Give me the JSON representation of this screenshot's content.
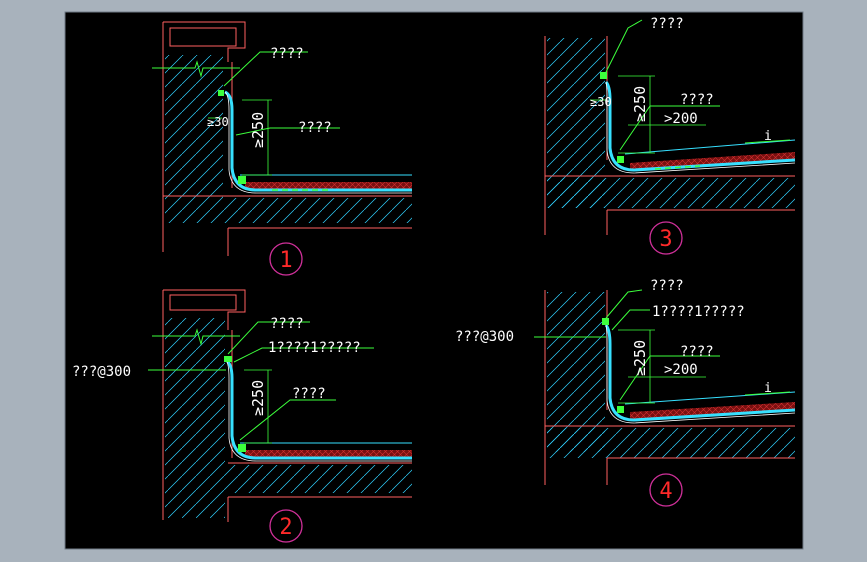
{
  "colors": {
    "frame": "#a8b2bc",
    "frame_edge": "#6f7a86",
    "background": "#000000",
    "concrete_outline": "#ff6060",
    "hatch": "#2fd2ff",
    "membrane": "#36e0ff",
    "leader": "#3cff3c",
    "text": "#ffffff",
    "circle": "#d0309a",
    "circle_text": "#ff2a2a",
    "fill_red": "#9a1818"
  },
  "details": [
    {
      "number": "1",
      "callout_top": "????",
      "dim_30": "≥30",
      "dim_250": "≥250",
      "callout_mid": "????"
    },
    {
      "number": "2",
      "callout_top": "????",
      "callout_mid2": "1????1?????",
      "dim_250": "≥250",
      "callout_mid": "????",
      "side_label": "???@300"
    },
    {
      "number": "3",
      "callout_top": "????",
      "dim_30": "≥30",
      "dim_250": "≥250",
      "callout_mid": "????",
      "dim_200": ">200",
      "slope": "i"
    },
    {
      "number": "4",
      "callout_top": "????",
      "callout_mid2": "1????1?????",
      "side_label": "???@300",
      "dim_250": "≥250",
      "callout_mid": "????",
      "dim_200": ">200",
      "slope": "i"
    }
  ]
}
